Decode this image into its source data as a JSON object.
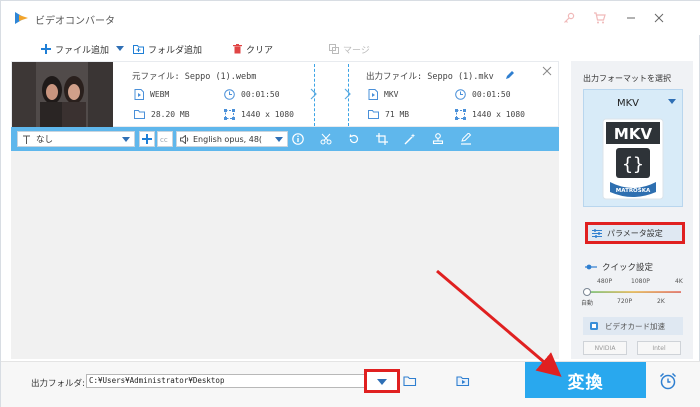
{
  "app": {
    "title": "ビデオコンバータ",
    "accent": "#29a8ee",
    "highlight": "#e02020"
  },
  "toolbar": {
    "add_file": "ファイル追加",
    "add_folder": "フォルダ追加",
    "clear": "クリア",
    "merge": "マージ"
  },
  "file": {
    "source_label": "元ファイル: Seppo (1).webm",
    "source_format": "WEBM",
    "source_duration": "00:01:50",
    "source_size": "28.20 MB",
    "source_resolution": "1440 x 1080",
    "output_label": "出力ファイル: Seppo (1).mkv",
    "output_format": "MKV",
    "output_duration": "00:01:50",
    "output_size": "71 MB",
    "output_resolution": "1440 x 1080"
  },
  "options": {
    "subtitle": "なし",
    "audio": "English opus, 48("
  },
  "right_panel": {
    "title": "出力フォーマットを選択",
    "format": "MKV",
    "format_badge_top": "MKV",
    "format_badge_bottom": "MATROŠKA",
    "params_button": "パラメータ設定",
    "quick_label": "クイック設定",
    "res_top": [
      "480P",
      "1080P",
      "4K"
    ],
    "res_bottom": [
      "自動",
      "720P",
      "2K"
    ],
    "gpu_button": "ビデオカード加速",
    "gpu_chips": [
      "NVIDIA",
      "Intel"
    ]
  },
  "bottom": {
    "folder_label": "出力フォルダ:",
    "folder_path": "C:¥Users¥Administrator¥Desktop",
    "convert": "変換"
  }
}
